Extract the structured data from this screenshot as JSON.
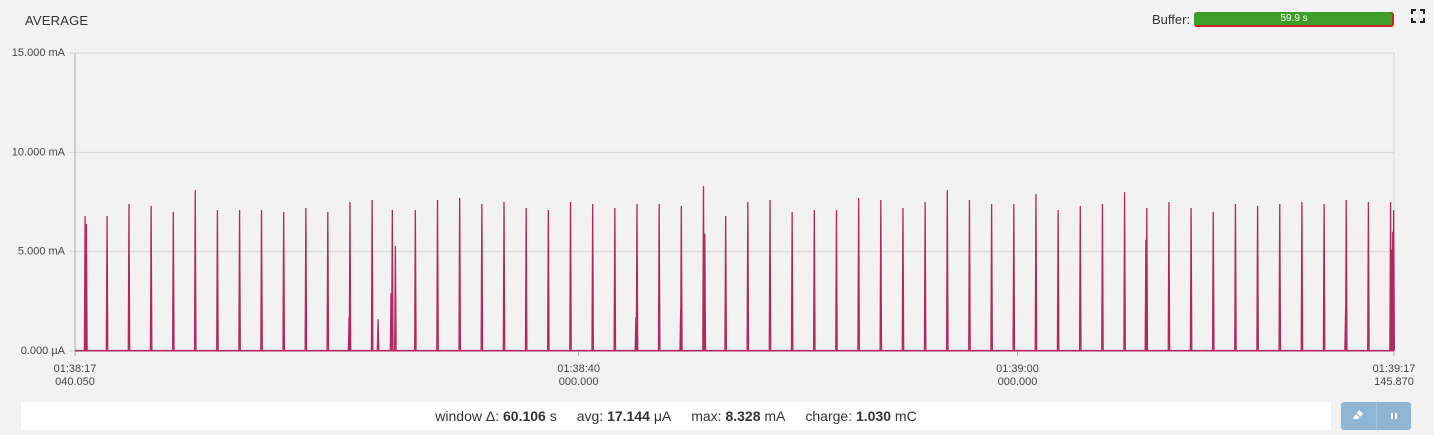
{
  "title": "AVERAGE",
  "buffer": {
    "label": "Buffer:",
    "value_text": "59.9 s",
    "fill_fraction": 0.99,
    "fill_color": "#3d9e2a",
    "track_color": "#c62828"
  },
  "icons": {
    "fullscreen": "fullscreen-icon",
    "eraser": "eraser-icon",
    "pause": "pause-icon"
  },
  "colors": {
    "trace": "#b0285f",
    "grid": "#d6d6d6",
    "axis": "#aaaaaa"
  },
  "stats": {
    "window": {
      "label": "window Δ:",
      "value": "60.106",
      "unit": "s"
    },
    "avg": {
      "label": "avg:",
      "value": "17.144",
      "unit": "μA"
    },
    "max": {
      "label": "max:",
      "value": "8.328",
      "unit": "mA"
    },
    "charge": {
      "label": "charge:",
      "value": "1.030",
      "unit": "mC"
    }
  },
  "chart_data": {
    "type": "line",
    "title": "AVERAGE",
    "xlabel": "",
    "ylabel": "",
    "xlim": [
      0,
      60.106
    ],
    "ylim": [
      0,
      15
    ],
    "y_unit": "mA",
    "y_ticks": [
      {
        "value": 0,
        "label": "0.000 µA"
      },
      {
        "value": 5,
        "label": "5.000 mA"
      },
      {
        "value": 10,
        "label": "10.000 mA"
      },
      {
        "value": 15,
        "label": "15.000 mA"
      }
    ],
    "x_ticks": [
      {
        "t": 0,
        "line1": "01:38:17",
        "line2": "040.050"
      },
      {
        "t": 22.95,
        "line1": "01:38:40",
        "line2": "000.000"
      },
      {
        "t": 42.95,
        "line1": "01:39:00",
        "line2": "000.000"
      },
      {
        "t": 60.106,
        "line1": "01:39:17",
        "line2": "145.870"
      }
    ],
    "grid": true,
    "baseline_mA": 0.017,
    "series": [
      {
        "spikes": [
          {
            "t": 0.46,
            "v": 6.8
          },
          {
            "t": 0.52,
            "v": 6.4
          },
          {
            "t": 1.46,
            "v": 6.8
          },
          {
            "t": 2.46,
            "v": 7.4
          },
          {
            "t": 3.47,
            "v": 7.3
          },
          {
            "t": 4.48,
            "v": 7.0
          },
          {
            "t": 5.48,
            "v": 8.1
          },
          {
            "t": 6.49,
            "v": 7.1
          },
          {
            "t": 7.5,
            "v": 7.1
          },
          {
            "t": 8.5,
            "v": 7.1
          },
          {
            "t": 9.51,
            "v": 7.0
          },
          {
            "t": 10.52,
            "v": 7.2
          },
          {
            "t": 11.52,
            "v": 7.0
          },
          {
            "t": 12.49,
            "v": 1.7
          },
          {
            "t": 12.53,
            "v": 7.5
          },
          {
            "t": 13.54,
            "v": 7.6
          },
          {
            "t": 13.81,
            "v": 1.6
          },
          {
            "t": 14.4,
            "v": 2.9
          },
          {
            "t": 14.46,
            "v": 7.1
          },
          {
            "t": 14.6,
            "v": 5.3
          },
          {
            "t": 15.51,
            "v": 7.1
          },
          {
            "t": 16.52,
            "v": 7.6
          },
          {
            "t": 17.53,
            "v": 7.7
          },
          {
            "t": 18.54,
            "v": 7.4
          },
          {
            "t": 19.55,
            "v": 7.5
          },
          {
            "t": 20.56,
            "v": 7.2
          },
          {
            "t": 21.57,
            "v": 7.1
          },
          {
            "t": 22.58,
            "v": 7.5
          },
          {
            "t": 23.59,
            "v": 7.4
          },
          {
            "t": 24.6,
            "v": 7.2
          },
          {
            "t": 25.61,
            "v": 7.4
          },
          {
            "t": 25.56,
            "v": 1.7
          },
          {
            "t": 26.62,
            "v": 7.4
          },
          {
            "t": 27.6,
            "v": 2.1
          },
          {
            "t": 27.63,
            "v": 7.3
          },
          {
            "t": 28.64,
            "v": 8.3
          },
          {
            "t": 28.7,
            "v": 5.9
          },
          {
            "t": 29.65,
            "v": 6.8
          },
          {
            "t": 30.66,
            "v": 7.5
          },
          {
            "t": 31.67,
            "v": 7.6
          },
          {
            "t": 32.68,
            "v": 7.0
          },
          {
            "t": 33.69,
            "v": 7.1
          },
          {
            "t": 34.7,
            "v": 7.1
          },
          {
            "t": 35.71,
            "v": 7.7
          },
          {
            "t": 36.72,
            "v": 7.6
          },
          {
            "t": 37.73,
            "v": 7.2
          },
          {
            "t": 38.74,
            "v": 7.5
          },
          {
            "t": 39.75,
            "v": 8.1
          },
          {
            "t": 40.76,
            "v": 7.6
          },
          {
            "t": 41.77,
            "v": 7.4
          },
          {
            "t": 42.78,
            "v": 7.4
          },
          {
            "t": 43.79,
            "v": 7.9
          },
          {
            "t": 44.8,
            "v": 7.1
          },
          {
            "t": 45.81,
            "v": 7.3
          },
          {
            "t": 46.82,
            "v": 7.4
          },
          {
            "t": 47.83,
            "v": 8.0
          },
          {
            "t": 48.8,
            "v": 5.6
          },
          {
            "t": 48.84,
            "v": 7.2
          },
          {
            "t": 49.85,
            "v": 7.5
          },
          {
            "t": 50.86,
            "v": 7.2
          },
          {
            "t": 51.87,
            "v": 7.0
          },
          {
            "t": 52.88,
            "v": 7.4
          },
          {
            "t": 53.89,
            "v": 7.3
          },
          {
            "t": 54.9,
            "v": 7.4
          },
          {
            "t": 55.91,
            "v": 7.5
          },
          {
            "t": 56.92,
            "v": 7.4
          },
          {
            "t": 57.9,
            "v": 2.0
          },
          {
            "t": 57.93,
            "v": 7.6
          },
          {
            "t": 58.94,
            "v": 7.5
          },
          {
            "t": 59.95,
            "v": 7.5
          },
          {
            "t": 60.0,
            "v": 5.1
          },
          {
            "t": 60.05,
            "v": 6.0
          },
          {
            "t": 60.09,
            "v": 7.1
          }
        ]
      }
    ]
  }
}
